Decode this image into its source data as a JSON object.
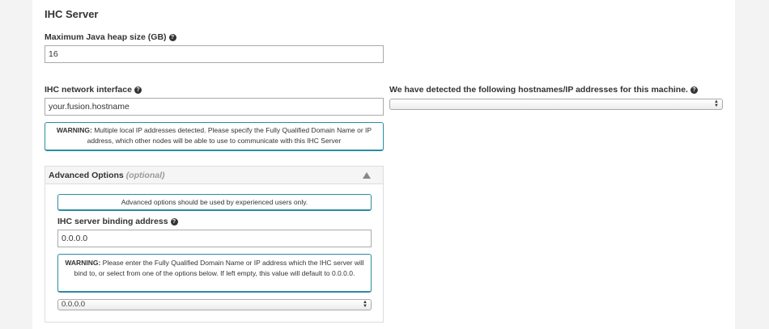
{
  "section": {
    "title": "IHC Server"
  },
  "heap": {
    "label": "Maximum Java heap size (GB)",
    "value": "16"
  },
  "network": {
    "label": "IHC network interface",
    "value": "your.fusion.hostname",
    "warning_prefix": "WARNING:",
    "warning_text": "Multiple local IP addresses detected. Please specify the Fully Qualified Domain Name or IP address, which other nodes will be able to use to communicate with this IHC Server"
  },
  "detected": {
    "label": "We have detected the following hostnames/IP addresses for this machine.",
    "selected": ""
  },
  "advanced": {
    "title": "Advanced Options",
    "optional": "(optional)",
    "notice": "Advanced options should be used by experienced users only.",
    "binding_label": "IHC server binding address",
    "binding_value": "0.0.0.0",
    "warning_prefix": "WARNING:",
    "warning_text": "Please enter the Fully Qualified Domain Name or IP address which the IHC server will bind to, or select from one of the options below. If left empty, this value will default to 0.0.0.0.",
    "binding_select": "0.0.0.0"
  },
  "icons": {
    "help": "question-circle-icon",
    "collapse": "triangle-up-icon",
    "select_arrows": "up-down-arrows-icon"
  },
  "colors": {
    "notice_border": "#2a8da0",
    "page_bg": "#f3f3f3",
    "panel_bg": "#ffffff"
  }
}
